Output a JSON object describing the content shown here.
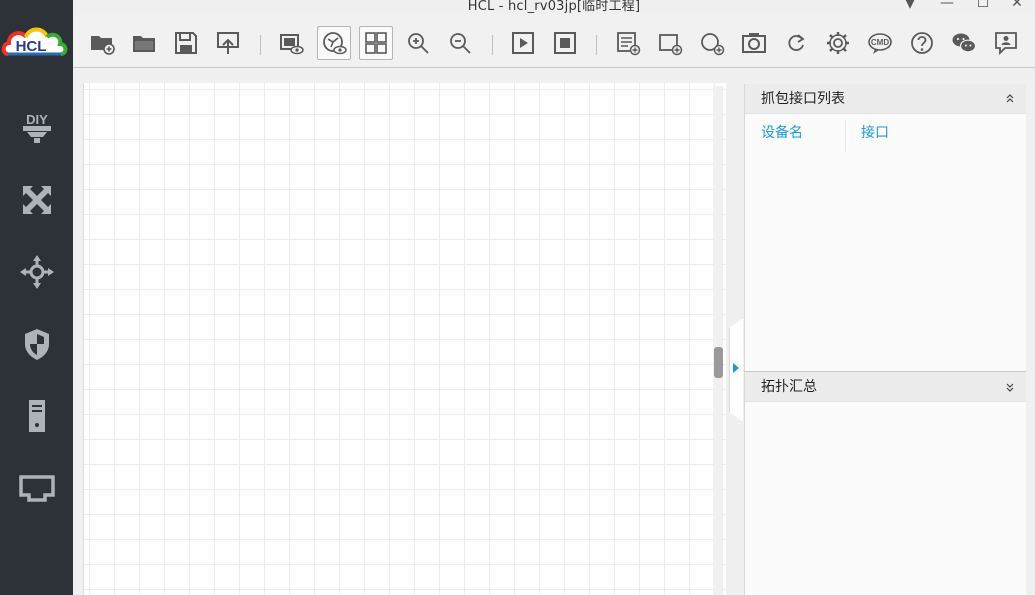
{
  "window": {
    "title": "HCL - hcl_rv03jp[临时工程]",
    "controls": [
      "dropdown-icon",
      "minimize-icon",
      "maximize-icon",
      "close-icon"
    ]
  },
  "logo": {
    "text": "HCL"
  },
  "sidebar": {
    "items": [
      {
        "name": "diy",
        "icon": "diy-icon"
      },
      {
        "name": "switch",
        "icon": "switch-arrows-icon"
      },
      {
        "name": "router",
        "icon": "router-icon"
      },
      {
        "name": "firewall",
        "icon": "shield-icon"
      },
      {
        "name": "server",
        "icon": "server-icon"
      },
      {
        "name": "terminal",
        "icon": "port-icon"
      }
    ]
  },
  "toolbar": {
    "buttons": [
      "new-project-icon",
      "open-folder-icon",
      "save-icon",
      "export-icon",
      "show-label-icon",
      "topology-view-icon",
      "grid-view-icon",
      "zoom-in-icon",
      "zoom-out-icon",
      "start-icon",
      "stop-icon",
      "capture-list-icon",
      "add-device-icon",
      "add-link-icon",
      "screenshot-icon",
      "refresh-icon",
      "settings-icon",
      "cmd-icon",
      "help-icon",
      "wechat-icon",
      "feedback-icon"
    ],
    "cmd_label": "CMD"
  },
  "capture_panel": {
    "title": "抓包接口列表",
    "columns": [
      "设备名",
      "接口"
    ]
  },
  "topology_panel": {
    "title": "拓扑汇总"
  },
  "colors": {
    "accent": "#1a9bd7",
    "sidebar_bg": "#2d3138",
    "logo_red": "#e8332a",
    "logo_yellow": "#f6c311",
    "logo_green": "#3aa935",
    "logo_blue": "#2a6bb5"
  }
}
